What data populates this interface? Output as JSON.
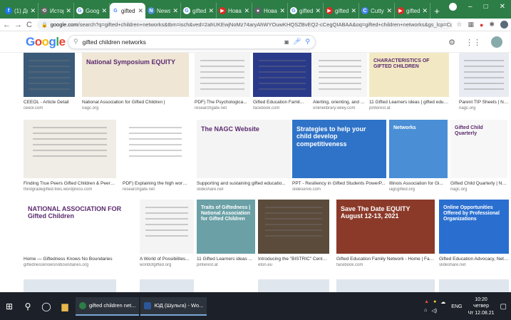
{
  "browser": {
    "tabs": [
      {
        "label": "(1) Дс",
        "fav_color": "#1877f2",
        "fav_glyph": "f"
      },
      {
        "label": "Истор",
        "fav_color": "#666666",
        "fav_glyph": "⟲"
      },
      {
        "label": "Goog",
        "fav_color": "#ffffff",
        "fav_glyph": "G"
      },
      {
        "label": "gifted",
        "fav_color": "#ffffff",
        "fav_glyph": "G",
        "active": true
      },
      {
        "label": "News",
        "fav_color": "#4a90d9",
        "fav_glyph": "N"
      },
      {
        "label": "gifted",
        "fav_color": "#ffffff",
        "fav_glyph": "G"
      },
      {
        "label": "Нова",
        "fav_color": "#e02b20",
        "fav_glyph": "▶"
      },
      {
        "label": "Новая",
        "fav_color": "#5f6368",
        "fav_glyph": "●"
      },
      {
        "label": "gifted",
        "fav_color": "#ffffff",
        "fav_glyph": "G"
      },
      {
        "label": "gifted",
        "fav_color": "#e02b20",
        "fav_glyph": "▶"
      },
      {
        "label": "Cutty",
        "fav_color": "#4285f4",
        "fav_glyph": "C"
      },
      {
        "label": "gifted",
        "fav_color": "#e02b20",
        "fav_glyph": "▶"
      }
    ],
    "new_tab": "+",
    "window_controls": {
      "minimize": "–",
      "maximize": "□",
      "close": "✕"
    },
    "nav": {
      "back": "←",
      "forward": "→",
      "reload": "C"
    },
    "url_host": "google.com",
    "url_rest": "/search?q=gifted+children+networks&tbm=isch&ved=2ahUKEwjNoMz74aryAhWYOuwKHQSZBvEQ2-cCegQIABAA&oq=gifted+children+networks&gs_lcp=CgN..."
  },
  "google": {
    "logo": [
      "G",
      "o",
      "o",
      "g",
      "l",
      "e"
    ],
    "query": "gifted children networks"
  },
  "results": [
    {
      "caption": "CEEOL - Article Detail",
      "source": "ceeol.com",
      "thumb_text": "",
      "bg": "#3b5a78"
    },
    {
      "caption": "National Association for Gifted Children |",
      "source": "nagc.org",
      "thumb_text": "National Symposium EQUITY",
      "bg": "#efe6d6"
    },
    {
      "caption": "PDF) The Psychologica...",
      "source": "researchgate.net",
      "thumb_text": "",
      "bg": "#f4f4f4"
    },
    {
      "caption": "Gifted Education Famil...",
      "source": "facebook.com",
      "thumb_text": "",
      "bg": "#2a3a8a"
    },
    {
      "caption": "Alerting, orienting, and ...",
      "source": "onlinelibrary.wiley.com",
      "thumb_text": "",
      "bg": "#f6f6f6"
    },
    {
      "caption": "11 Gifted Learners ideas | gifted educat...",
      "source": "pinterest.at",
      "thumb_text": "CHARACTERISTICS OF GIFTED CHILDREN",
      "bg": "#f2e9c4"
    },
    {
      "caption": "Parent TIP Sheets | Nat...",
      "source": "nagc.org",
      "thumb_text": "",
      "bg": "#e8ecf2"
    },
    {
      "caption": "Finding True Peers Gifted Children & Peer Re...",
      "source": "thirdgradegifted.files.wordpress.com",
      "thumb_text": "",
      "bg": "#f0ece6"
    },
    {
      "caption": "PDF) Explaining the high workin...",
      "source": "researchgate.net",
      "thumb_text": "",
      "bg": "#ffffff"
    },
    {
      "caption": "Supporting and sustaining gifted educatio...",
      "source": "slideshare.net",
      "thumb_text": "The NAGC Website",
      "bg": "#f4f4f4"
    },
    {
      "caption": "PPT - Resiliency in Gifted Students PowerP...",
      "source": "slideserve.com",
      "thumb_text": "Strategies to help your child develop competitiveness",
      "bg": "#2f73c8"
    },
    {
      "caption": "Illinois Association for Gi...",
      "source": "iagcgifted.org",
      "thumb_text": "Networks",
      "bg": "#4a8fd6"
    },
    {
      "caption": "Gifted Child Quarterly | Nat...",
      "source": "nagc.org",
      "thumb_text": "Gifted Child Quarterly",
      "bg": "#f7f7f7"
    },
    {
      "caption": "Home — Giftedness Knows No Boundaries",
      "source": "giftednesskriowsnoboundaries.org",
      "thumb_text": "NATIONAL ASSOCIATION FOR Gifted Children",
      "bg": "#ffffff"
    },
    {
      "caption": "A World of Possibilites...",
      "source": "worldofgifted.org",
      "thumb_text": "",
      "bg": "#f4f4f4"
    },
    {
      "caption": "11 Gifted Learners ideas ...",
      "source": "pinterest.at",
      "thumb_text": "Traits of Giftedness | National Association for Gifted Children",
      "bg": "#6aa0a6"
    },
    {
      "caption": "Introducing the \"BISTRIC\" Center ...",
      "source": "eton.eu",
      "thumb_text": "",
      "bg": "#5b4b3b"
    },
    {
      "caption": "Gifted Education Family Network - Home | Fac...",
      "source": "facebook.com",
      "thumb_text": "Save The Date EQUITY August 12-13, 2021",
      "bg": "#8b3a2a"
    },
    {
      "caption": "Gifted Education Advocacy, Netw...",
      "source": "slideshare.net",
      "thumb_text": "Online Opportunities Offered by Professional Organizations",
      "bg": "#2a6fd0"
    }
  ],
  "taskbar": {
    "apps": [
      {
        "label": "gifted children net...",
        "color": "#2d7d46"
      },
      {
        "label": "ЮД (Шульга) - Wo...",
        "color": "#2b579a"
      }
    ],
    "lang": "ENG",
    "time": "10:20",
    "day": "четвер",
    "date": "Чт 12.08.21"
  }
}
